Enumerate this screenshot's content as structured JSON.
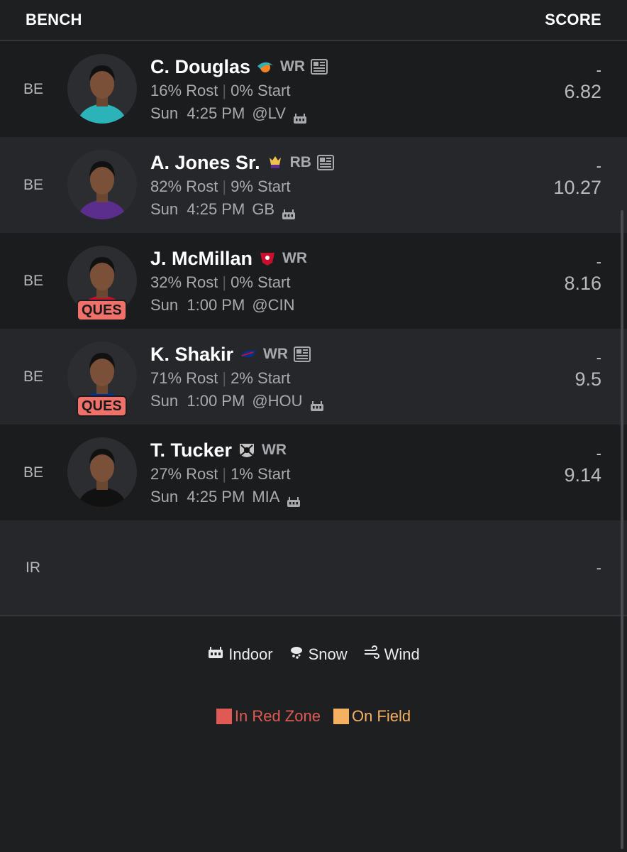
{
  "header": {
    "left": "BENCH",
    "right": "SCORE"
  },
  "players": [
    {
      "slot": "BE",
      "name": "C. Douglas",
      "team_icon": "dolphins-logo-icon",
      "pos": "WR",
      "news": true,
      "rost": "16% Rost",
      "start": "0% Start",
      "day_time": "Sun  4:25 PM",
      "opp": "@LV",
      "indoor": true,
      "score_dash": "-",
      "projection": "6.82",
      "status": "",
      "jersey_color": "#2bb3b9"
    },
    {
      "slot": "BE",
      "name": "A. Jones Sr.",
      "team_icon": "vikings-logo-icon",
      "pos": "RB",
      "news": true,
      "rost": "82% Rost",
      "start": "9% Start",
      "day_time": "Sun  4:25 PM",
      "opp": "GB",
      "indoor": true,
      "score_dash": "-",
      "projection": "10.27",
      "status": "",
      "jersey_color": "#5b2d8c"
    },
    {
      "slot": "BE",
      "name": "J. McMillan",
      "team_icon": "buccaneers-logo-icon",
      "pos": "WR",
      "news": false,
      "rost": "32% Rost",
      "start": "0% Start",
      "day_time": "Sun  1:00 PM",
      "opp": "@CIN",
      "indoor": false,
      "score_dash": "-",
      "projection": "8.16",
      "status": "QUES",
      "jersey_color": "#c8102e"
    },
    {
      "slot": "BE",
      "name": "K. Shakir",
      "team_icon": "bills-logo-icon",
      "pos": "WR",
      "news": true,
      "rost": "71% Rost",
      "start": "2% Start",
      "day_time": "Sun  1:00 PM",
      "opp": "@HOU",
      "indoor": true,
      "score_dash": "-",
      "projection": "9.5",
      "status": "QUES",
      "jersey_color": "#00338d"
    },
    {
      "slot": "BE",
      "name": "T. Tucker",
      "team_icon": "raiders-logo-icon",
      "pos": "WR",
      "news": false,
      "rost": "27% Rost",
      "start": "1% Start",
      "day_time": "Sun  4:25 PM",
      "opp": "MIA",
      "indoor": true,
      "score_dash": "-",
      "projection": "9.14",
      "status": "",
      "jersey_color": "#111111"
    }
  ],
  "ir": {
    "slot": "IR",
    "score": "-"
  },
  "legend": {
    "indoor": "Indoor",
    "snow": "Snow",
    "wind": "Wind",
    "red_zone": "In Red Zone",
    "on_field": "On Field",
    "red_zone_color": "#e05a55",
    "on_field_color": "#f4b162"
  }
}
